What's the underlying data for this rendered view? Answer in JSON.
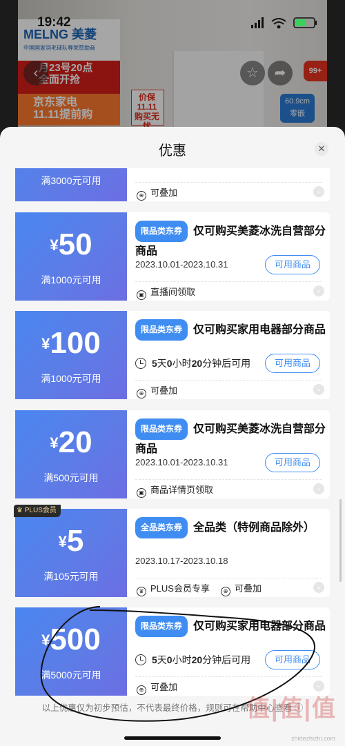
{
  "status_bar": {
    "time": "19:42"
  },
  "background_page": {
    "brand": "MELNG 美菱",
    "brand_sub": "中国国家羽毛球队尊荣赞助商",
    "promo_date": "月23号20点",
    "promo_date_sub": "全面开抢",
    "promo_event": "京东家电",
    "promo_event_sub": "11.11提前购",
    "price_tag_line1": "价保",
    "price_tag_line2": "11.11",
    "price_tag_line3": "购买无忧",
    "size_badge_line1": "60.9cm",
    "size_badge_line2": "零嵌",
    "count_badge": "99+"
  },
  "sheet": {
    "title": "优惠",
    "footer": "以上优惠仅为初步预估，不代表最终价格，规则可在帮助中心查看"
  },
  "coupons": [
    {
      "amount": "",
      "condition": "满3000元可用",
      "meta1": "可叠加"
    },
    {
      "currency": "¥",
      "amount": "50",
      "condition": "满1000元可用",
      "tag": "限品类东券",
      "title": "仅可购买美菱冰洗自营部分商品",
      "date": "2023.10.01-2023.10.31",
      "button": "可用商品",
      "meta1": "直播间领取"
    },
    {
      "currency": "¥",
      "amount": "100",
      "condition": "满1000元可用",
      "tag": "限品类东券",
      "title": "仅可购买家用电器部分商品",
      "countdown_a": "5",
      "countdown_b": "天",
      "countdown_c": "0",
      "countdown_d": "小时",
      "countdown_e": "20",
      "countdown_f": "分钟后可用",
      "button": "可用商品",
      "meta1": "可叠加"
    },
    {
      "currency": "¥",
      "amount": "20",
      "condition": "满500元可用",
      "tag": "限品类东券",
      "title": "仅可购买美菱冰洗自营部分商品",
      "date": "2023.10.01-2023.10.31",
      "button": "可用商品",
      "meta1": "商品详情页领取"
    },
    {
      "badge": "PLUS会员",
      "currency": "¥",
      "amount": "5",
      "condition": "满105元可用",
      "tag": "全品类东券",
      "title": "全品类（特例商品除外）",
      "date": "2023.10.17-2023.10.18",
      "meta1": "PLUS会员专享",
      "meta2": "可叠加"
    },
    {
      "currency": "¥",
      "amount": "500",
      "condition": "满5000元可用",
      "tag": "限品类东券",
      "title": "仅可购买家用电器部分商品",
      "countdown_a": "5",
      "countdown_b": "天",
      "countdown_c": "0",
      "countdown_d": "小时",
      "countdown_e": "20",
      "countdown_f": "分钟后可用",
      "button": "可用商品",
      "meta1": "可叠加"
    }
  ],
  "icons": {
    "close": "close-icon",
    "back": "back-arrow-icon",
    "favorite": "star-icon",
    "share": "share-icon",
    "expand": "chevron-down-icon"
  },
  "watermark": {
    "text": "值|值|值",
    "sub": "zhidezhizhi.com"
  },
  "colors": {
    "accent": "#3f8df2",
    "coupon_gradient_start": "#4a86f0",
    "coupon_gradient_end": "#6c6ee2"
  }
}
